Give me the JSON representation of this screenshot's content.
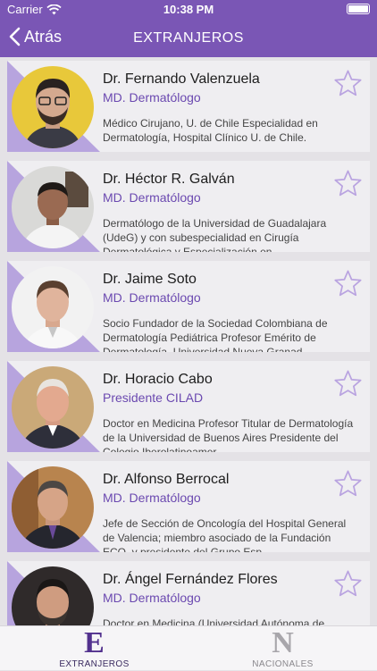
{
  "status_bar": {
    "carrier": "Carrier",
    "time": "10:38 PM",
    "icons": [
      "wifi-icon",
      "battery-icon"
    ]
  },
  "nav": {
    "back_label": "Atrás",
    "title": "EXTRANJEROS"
  },
  "colors": {
    "header": "#7a56b5",
    "accent_text": "#6b49b0",
    "card_triangle": "#b7a4de",
    "star_outline": "#b9a3e0"
  },
  "doctors": [
    {
      "name": "Dr. Fernando Valenzuela",
      "role": "MD. Dermatólogo",
      "desc": "Médico Cirujano, U. de Chile Especialidad en Dermatología, Hospital Clínico U. de Chile."
    },
    {
      "name": "Dr. Héctor R. Galván",
      "role": "MD. Dermatólogo",
      "desc": "Dermatólogo de la Universidad de Guadalajara (UdeG) y con subespecialidad en Cirugía Dermatológica y Especialización en…"
    },
    {
      "name": "Dr. Jaime Soto",
      "role": "MD. Dermatólogo",
      "desc": "Socio Fundador de la Sociedad Colombiana de Dermatología Pediátrica Profesor Emérito de Dermatología, Universidad Nueva Granad…"
    },
    {
      "name": "Dr. Horacio Cabo",
      "role": "Presidente CILAD",
      "desc": "Doctor en Medicina Profesor Titular de Dermatología de la Universidad de Buenos Aires Presidente del Colegio Iberolatinoamer…"
    },
    {
      "name": "Dr. Alfonso Berrocal",
      "role": "MD. Dermatólogo",
      "desc": "Jefe de Sección de Oncología del Hospital General de Valencia; miembro asociado de la Fundación ECO, y presidente del Grupo Esp…"
    },
    {
      "name": "Dr. Ángel Fernández Flores",
      "role": "MD. Dermatólogo",
      "desc": "Doctor en Medicina (Universidad Autónoma de Madrid). Formación en histopatología…"
    }
  ],
  "tabs": [
    {
      "letter": "E",
      "label": "EXTRANJEROS",
      "active": true
    },
    {
      "letter": "N",
      "label": "NACIONALES",
      "active": false
    }
  ]
}
